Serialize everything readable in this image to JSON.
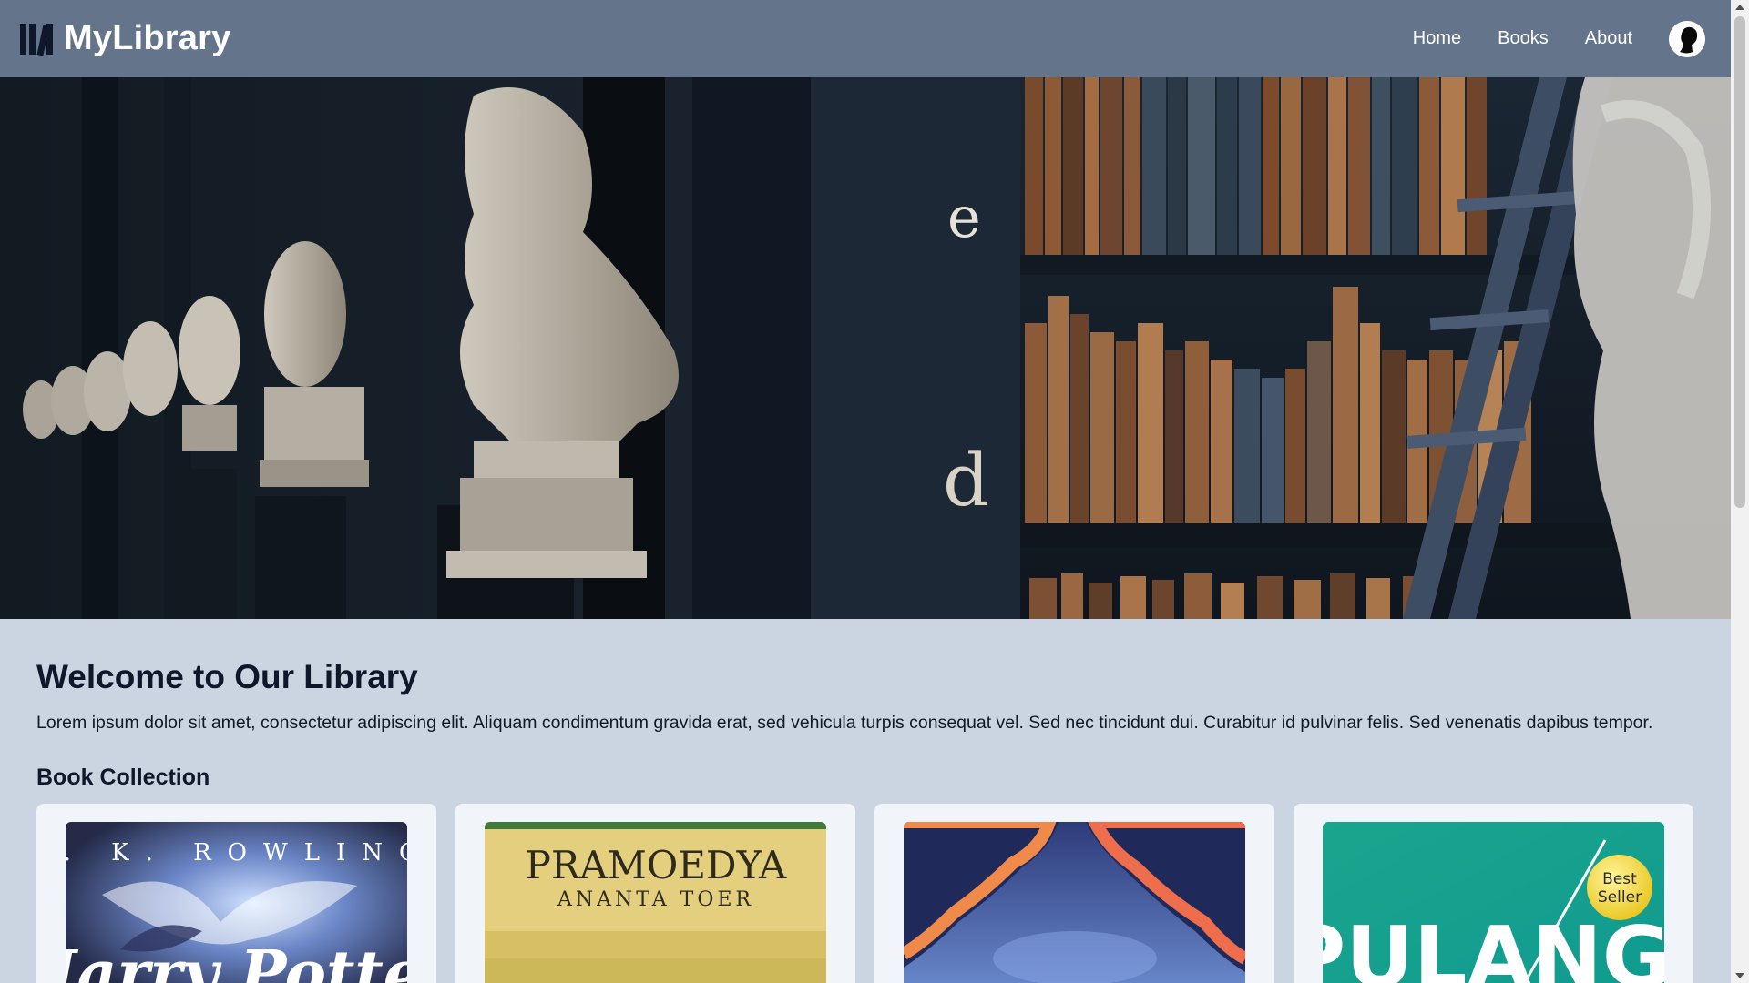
{
  "navbar": {
    "brand": "MyLibrary",
    "links": [
      "Home",
      "Books",
      "About"
    ]
  },
  "hero": {
    "shelf_letters": [
      "e",
      "d"
    ]
  },
  "main": {
    "welcome_title": "Welcome to Our Library",
    "welcome_text": "Lorem ipsum dolor sit amet, consectetur adipiscing elit. Aliquam condimentum gravida erat, sed vehicula turpis consequat vel. Sed nec tincidunt dui. Curabitur id pulvinar felis. Sed venenatis dapibus tempor.",
    "collection_title": "Book Collection"
  },
  "books": [
    {
      "cover_author": "J. K. ROWLING",
      "cover_title": "Harry Potter"
    },
    {
      "cover_author_line1": "PRAMOEDYA",
      "cover_author_line2": "ANANTA TOER"
    },
    {},
    {
      "cover_title": "PULANG",
      "badge_line1": "Best",
      "badge_line2": "Seller"
    }
  ],
  "colors": {
    "navbar": "#64748b",
    "page_background": "#cbd5e1",
    "card_background": "#f1f5f9",
    "text_dark": "#0f172a"
  }
}
